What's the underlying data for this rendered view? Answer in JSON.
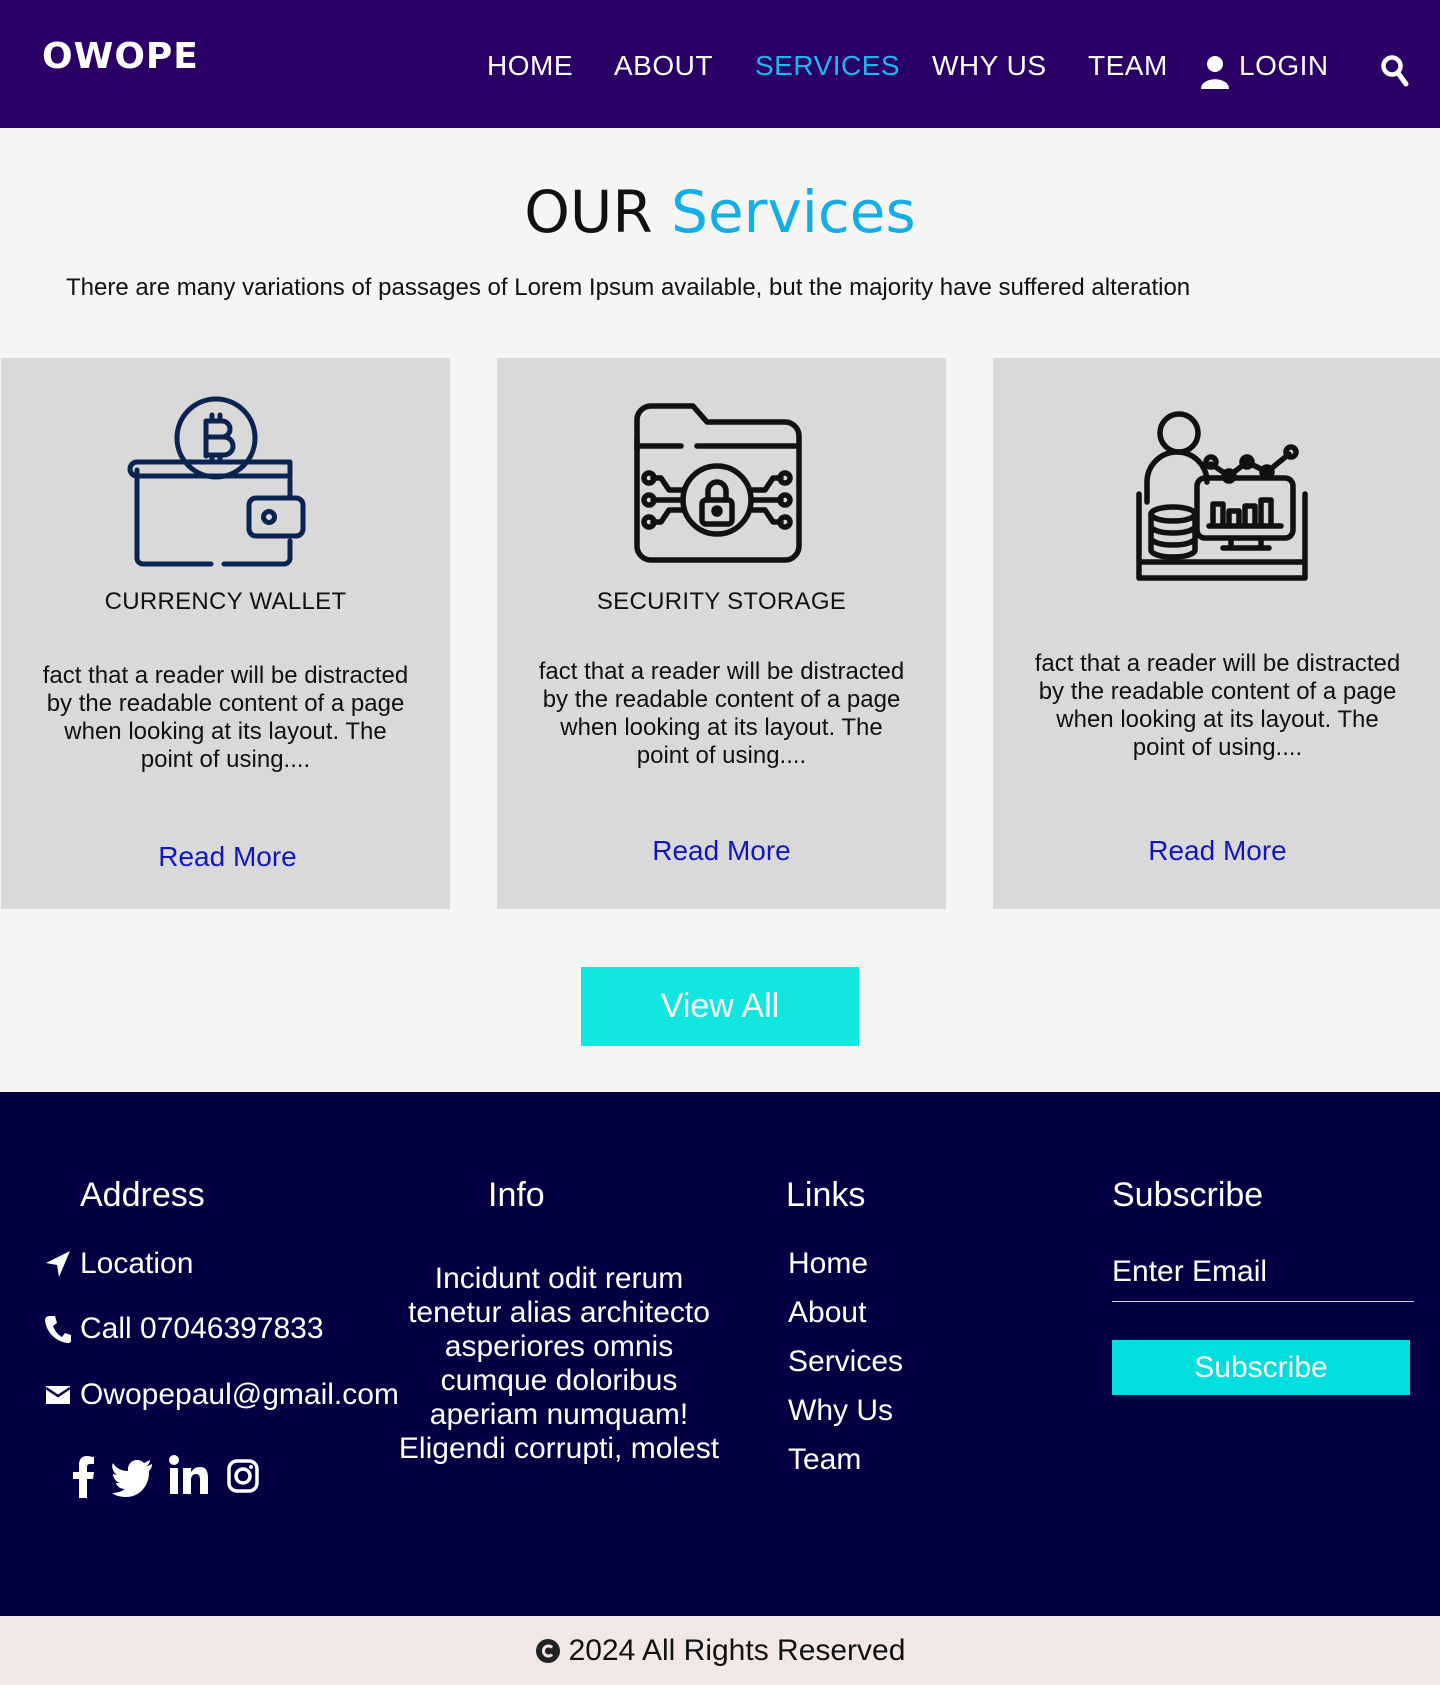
{
  "header": {
    "logo": "OWOPE",
    "nav": [
      {
        "label": "HOME"
      },
      {
        "label": "ABOUT"
      },
      {
        "label": "SERVICES",
        "active": true
      },
      {
        "label": "WHY US"
      },
      {
        "label": "TEAM"
      },
      {
        "label": "LOGIN"
      }
    ],
    "icons": [
      "user-icon",
      "search-icon"
    ]
  },
  "services": {
    "title_main": "OUR",
    "title_accent": "Services",
    "subtitle": "There are many variations of passages of Lorem Ipsum available, but the majority have suffered alteration",
    "cards": [
      {
        "icon": "bitcoin-wallet-icon",
        "title": "CURRENCY WALLET",
        "text": "fact that a reader will be distracted by the readable content of a page when looking at its layout. The point of using....",
        "link": "Read More"
      },
      {
        "icon": "secure-folder-icon",
        "title": "SECURITY STORAGE",
        "text": "fact that a reader will be distracted by the readable content of a page when looking at its layout. The point of using....",
        "link": "Read More"
      },
      {
        "icon": "analytics-person-icon",
        "title": "",
        "text": "fact that a reader will be distracted by the readable content of a page when looking at its layout. The point of using....",
        "link": "Read More"
      }
    ],
    "view_all": "View All"
  },
  "footer": {
    "address": {
      "heading": "Address",
      "location": "Location",
      "call": "Call 07046397833",
      "email": "Owopepaul@gmail.com"
    },
    "info": {
      "heading": "Info",
      "text": "Incidunt odit rerum tenetur alias architecto asperiores omnis cumque doloribus aperiam numquam! Eligendi corrupti, molest"
    },
    "links": {
      "heading": "Links",
      "items": [
        "Home",
        "About",
        "Services",
        "Why Us",
        "Team"
      ]
    },
    "subscribe": {
      "heading": "Subscribe",
      "placeholder": "Enter Email",
      "button": "Subscribe"
    },
    "social": [
      "facebook-icon",
      "twitter-icon",
      "linkedin-icon",
      "instagram-icon"
    ]
  },
  "bottom": {
    "copyright": "2024 All Rights Reserved"
  },
  "colors": {
    "header_bg": "#2b0066",
    "footer_bg": "#020042",
    "accent": "#14aee6",
    "button": "#12e6e0",
    "link": "#1018b8"
  }
}
